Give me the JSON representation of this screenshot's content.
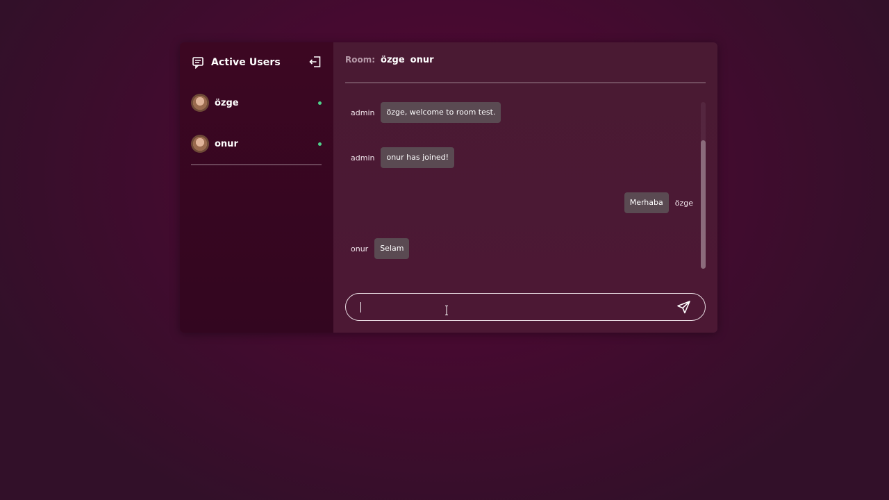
{
  "sidebar": {
    "title": "Active Users",
    "title_icon": "chat-bubble-icon",
    "logout_icon": "logout-icon",
    "users": [
      {
        "name": "özge",
        "status": "online"
      },
      {
        "name": "onur",
        "status": "online"
      }
    ]
  },
  "room": {
    "label": "Room:",
    "users": [
      "özge",
      "onur"
    ]
  },
  "messages": [
    {
      "sender": "admin",
      "text": "özge, welcome to room test.",
      "side": "left"
    },
    {
      "sender": "admin",
      "text": "onur has joined!",
      "side": "left"
    },
    {
      "sender": "özge",
      "text": "Merhaba",
      "side": "right"
    },
    {
      "sender": "onur",
      "text": "Selam",
      "side": "left"
    }
  ],
  "composer": {
    "value": "",
    "placeholder": "",
    "send_icon": "send-icon"
  },
  "colors": {
    "online": "#4fd18b",
    "bubble": "#5a4a52",
    "background": "#4a0a30"
  }
}
